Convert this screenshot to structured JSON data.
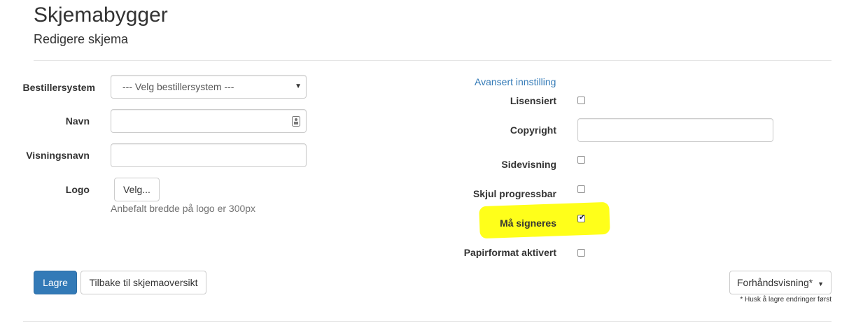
{
  "header": {
    "title": "Skjemabygger",
    "subtitle": "Redigere skjema"
  },
  "left_form": {
    "bestillersystem_label": "Bestillersystem",
    "bestillersystem_value": "--- Velg bestillersystem ---",
    "navn_label": "Navn",
    "navn_value": "",
    "visningsnavn_label": "Visningsnavn",
    "visningsnavn_value": "",
    "logo_label": "Logo",
    "logo_button": "Velg...",
    "logo_help": "Anbefalt bredde på logo er 300px"
  },
  "right_form": {
    "advanced_link": "Avansert innstilling",
    "lisensiert_label": "Lisensiert",
    "lisensiert_checked": false,
    "copyright_label": "Copyright",
    "copyright_value": "",
    "sidevisning_label": "Sidevisning",
    "sidevisning_checked": false,
    "skjul_progressbar_label": "Skjul progressbar",
    "skjul_progressbar_checked": false,
    "ma_signeres_label": "Må signeres",
    "ma_signeres_checked": true,
    "papirformat_label": "Papirformat aktivert",
    "papirformat_checked": false
  },
  "footer": {
    "save_button": "Lagre",
    "back_button": "Tilbake til skjemaoversikt",
    "preview_button": "Forhåndsvisning*",
    "preview_note": "* Husk å lagre endringer først"
  },
  "colors": {
    "primary": "#337ab7",
    "highlight": "#ffff1a",
    "link": "#337ab7"
  }
}
